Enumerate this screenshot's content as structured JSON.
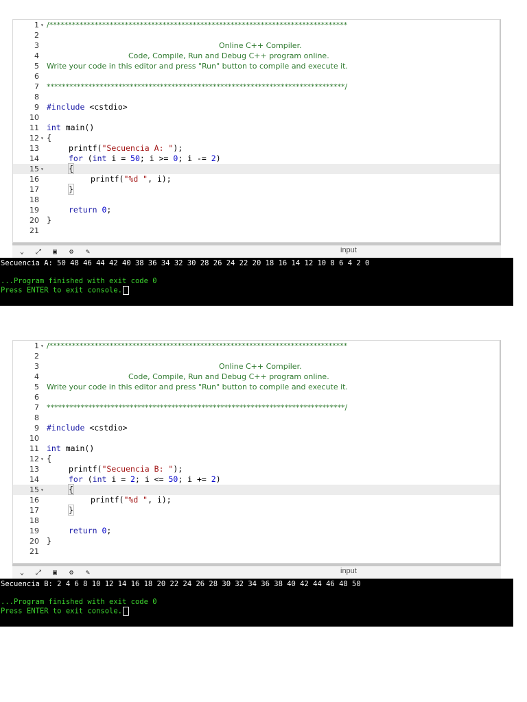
{
  "toolbar": {
    "input_label": "input"
  },
  "panels": [
    {
      "line_numbers": [
        "1",
        "2",
        "3",
        "4",
        "5",
        "6",
        "7",
        "8",
        "9",
        "10",
        "11",
        "12",
        "13",
        "14",
        "15",
        "16",
        "17",
        "18",
        "19",
        "20",
        "21"
      ],
      "comment_stars_top": "/*******************************************************************************",
      "comment_title": "Online C++ Compiler.",
      "comment_sub": "Code, Compile, Run and Debug C++ program online.",
      "comment_desc": "Write your code in this editor and press \"Run\" button to compile and execute it.",
      "comment_stars_bottom": "*******************************************************************************/",
      "include_kw": "#include",
      "include_lib": "<cstdio>",
      "main_type": "int",
      "main_sig": " main()",
      "open_brace": "{",
      "printf_name": "printf",
      "printf_str": "\"Secuencia A: \"",
      "for_kw": "for",
      "for_int": "int",
      "for_rest_a": " i = ",
      "for_start": "50",
      "for_rest_b": "; i >= ",
      "for_end": "0",
      "for_rest_c": "; i -= ",
      "for_step": "2",
      "inner_open": "{",
      "inner_printf_str": "\"%d \"",
      "inner_printf_rest": ", i);",
      "inner_close": "}",
      "return_kw": "return",
      "return_val": "0",
      "close_brace": "}",
      "console_output": "Secuencia A: 50 48 46 44 42 40 38 36 34 32 30 28 26 24 22 20 18 16 14 12 10 8 6 4 2 0",
      "console_finished": "...Program finished with exit code 0",
      "console_press": "Press ENTER to exit console."
    },
    {
      "line_numbers": [
        "1",
        "2",
        "3",
        "4",
        "5",
        "6",
        "7",
        "8",
        "9",
        "10",
        "11",
        "12",
        "13",
        "14",
        "15",
        "16",
        "17",
        "18",
        "19",
        "20",
        "21"
      ],
      "comment_stars_top": "/*******************************************************************************",
      "comment_title": "Online C++ Compiler.",
      "comment_sub": "Code, Compile, Run and Debug C++ program online.",
      "comment_desc": "Write your code in this editor and press \"Run\" button to compile and execute it.",
      "comment_stars_bottom": "*******************************************************************************/",
      "include_kw": "#include",
      "include_lib": "<cstdio>",
      "main_type": "int",
      "main_sig": " main()",
      "open_brace": "{",
      "printf_name": "printf",
      "printf_str": "\"Secuencia B: \"",
      "for_kw": "for",
      "for_int": "int",
      "for_rest_a": " i = ",
      "for_start": "2",
      "for_rest_b": "; i <= ",
      "for_end": "50",
      "for_rest_c": "; i += ",
      "for_step": "2",
      "inner_open": "{",
      "inner_printf_str": "\"%d \"",
      "inner_printf_rest": ", i);",
      "inner_close": "}",
      "return_kw": "return",
      "return_val": "0",
      "close_brace": "}",
      "console_output": "Secuencia B: 2 4 6 8 10 12 14 16 18 20 22 24 26 28 30 32 34 36 38 40 42 44 46 48 50",
      "console_finished": "...Program finished with exit code 0",
      "console_press": "Press ENTER to exit console."
    }
  ]
}
